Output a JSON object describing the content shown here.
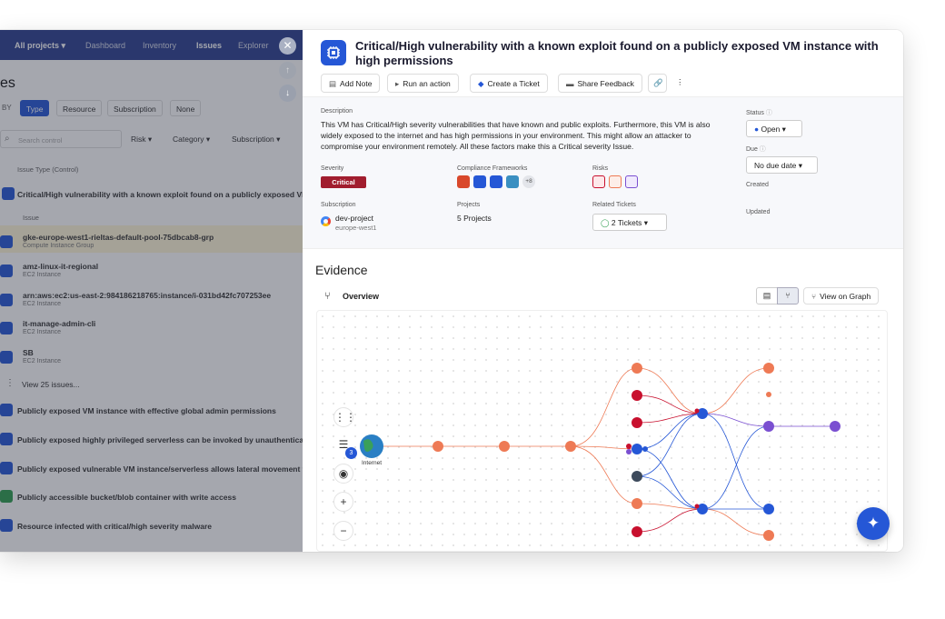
{
  "nav": {
    "projects": "All projects ▾",
    "items": [
      "Dashboard",
      "Inventory",
      "Issues",
      "Explorer"
    ]
  },
  "left": {
    "page_title": "es",
    "group_by_label": "BY",
    "group_tabs": [
      "Type",
      "Resource",
      "Subscription",
      "None"
    ],
    "search_placeholder": "Search control",
    "filters": [
      "Risk ▾",
      "Category ▾",
      "Subscription ▾"
    ],
    "column_header": "Issue Type (Control)",
    "issue_header": "Issue",
    "top_row": "Critical/High vulnerability with a known exploit found on a publicly exposed VM inst",
    "issues": [
      {
        "name": "gke-europe-west1-rieltas-default-pool-75dbcab8-grp",
        "type": "Compute Instance Group"
      },
      {
        "name": "amz-linux-it-regional",
        "type": "EC2 Instance"
      },
      {
        "name": "arn:aws:ec2:us-east-2:984186218765:instance/i-031bd42fc707253ee",
        "type": "EC2 Instance"
      },
      {
        "name": "it-manage-admin-cli",
        "type": "EC2 Instance"
      },
      {
        "name": "SB",
        "type": "EC2 Instance"
      }
    ],
    "view_more": "View 25 issues...",
    "controls": [
      "Publicly exposed VM instance with effective global admin permissions",
      "Publicly exposed highly privileged serverless can be invoked by unauthenticated us",
      "Publicly exposed vulnerable VM instance/serverless allows lateral movement to adm",
      "Publicly accessible bucket/blob container with write access",
      "Resource infected with critical/high severity malware"
    ]
  },
  "panel": {
    "title": "Critical/High vulnerability with a known exploit found on a publicly exposed VM instance with high permissions",
    "actions": [
      "Add Note",
      "Run an action",
      "Create a Ticket",
      "Share Feedback"
    ],
    "description_label": "Description",
    "description": "This VM has Critical/High severity vulnerabilities that have known and public exploits. Furthermore, this VM is also widely exposed to the internet and has high permissions in your environment. This might allow an attacker to compromise your environment remotely. All these factors make this a Critical severity Issue.",
    "severity_label": "Severity",
    "severity": "Critical",
    "compliance_label": "Compliance Frameworks",
    "compliance_more": "+8",
    "risks_label": "Risks",
    "subscription_label": "Subscription",
    "subscription": "dev-project",
    "subscription_region": "europe-west1",
    "projects_label": "Projects",
    "projects": "5 Projects",
    "tickets_label": "Related Tickets",
    "tickets": "2 Tickets",
    "status_label": "Status",
    "status": "Open",
    "due_label": "Due",
    "due": "No due date",
    "created_label": "Created",
    "updated_label": "Updated",
    "evidence": "Evidence",
    "overview": "Overview",
    "view_graph": "View on Graph",
    "internet_label": "Internet",
    "badge_count": "3"
  },
  "colors": {
    "nav": "#2b3f8f",
    "accent": "#2557d6",
    "critical": "#a11d2e",
    "orange": "#ee7a55",
    "red": "#c8102e",
    "purple": "#7a4fd1"
  }
}
